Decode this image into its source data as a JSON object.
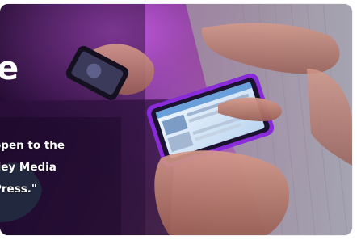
{
  "card": {
    "title_fragment": "e",
    "caption_lines": [
      "open to the",
      "lley Media",
      "Press.\""
    ]
  },
  "photo": {
    "subject": "hands-holding-smartphones",
    "accent": "#b22ee0"
  }
}
